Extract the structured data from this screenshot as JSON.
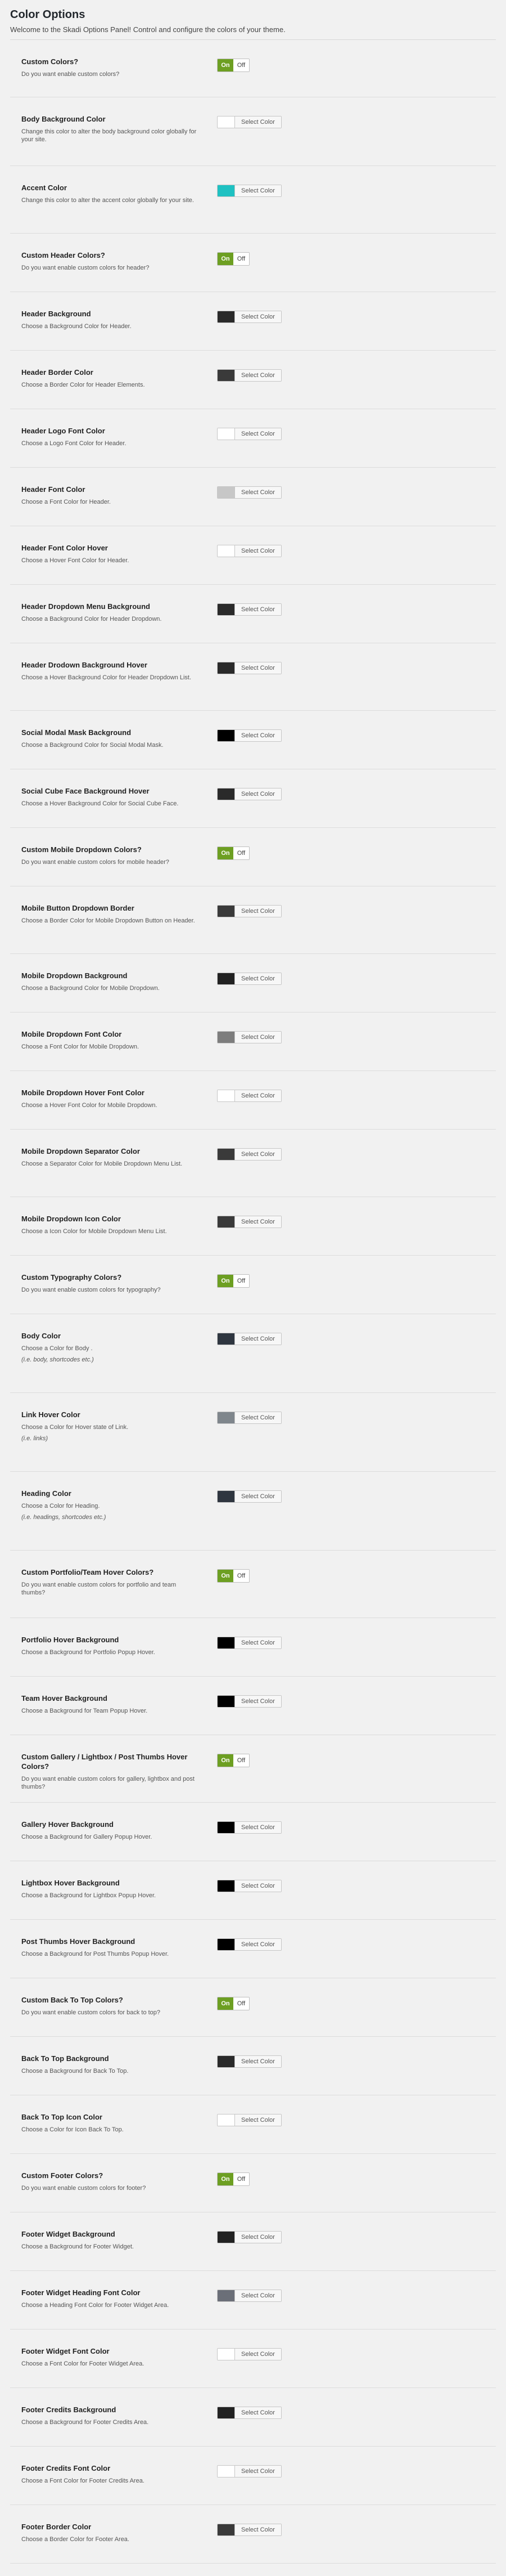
{
  "header": {
    "title": "Color Options",
    "intro": "Welcome to the Skadi Options Panel! Control and configure the colors of your theme."
  },
  "controls": {
    "on_label": "On",
    "off_label": "Off",
    "select_color_label": "Select Color"
  },
  "options": [
    {
      "kind": "toggle",
      "title": "Custom Colors?",
      "desc": "Do you want enable custom colors?",
      "value": "On"
    },
    {
      "kind": "color",
      "title": "Body Background Color",
      "desc": "Change this color to alter the body background color globally for your site.",
      "color": "#ffffff"
    },
    {
      "kind": "color",
      "title": "Accent Color",
      "desc": "Change this color to alter the accent color globally for your site.",
      "color": "#1fc1c2"
    },
    {
      "kind": "toggle",
      "title": "Custom Header Colors?",
      "desc": "Do you want enable custom colors for header?",
      "value": "On"
    },
    {
      "kind": "color",
      "title": "Header Background",
      "desc": "Choose a Background Color for Header.",
      "color": "#2a2a2a"
    },
    {
      "kind": "color",
      "title": "Header Border Color",
      "desc": "Choose a Border Color for Header Elements.",
      "color": "#3a3a3a"
    },
    {
      "kind": "color",
      "title": "Header Logo Font Color",
      "desc": "Choose a Logo Font Color for Header.",
      "color": "#ffffff"
    },
    {
      "kind": "color",
      "title": "Header Font Color",
      "desc": "Choose a Font Color for Header.",
      "color": "#c7c7c7"
    },
    {
      "kind": "color",
      "title": "Header Font Color Hover",
      "desc": "Choose a Hover Font Color for Header.",
      "color": "#ffffff"
    },
    {
      "kind": "color",
      "title": "Header Dropdown Menu Background",
      "desc": "Choose a Background Color for Header Dropdown.",
      "color": "#2a2a2a"
    },
    {
      "kind": "color",
      "title": "Header Drodown Background Hover",
      "desc": "Choose a Hover Background Color for Header Dropdown List.",
      "color": "#2a2a2a"
    },
    {
      "kind": "color",
      "title": "Social Modal Mask Background",
      "desc": "Choose a Background Color for Social Modal Mask.",
      "color": "#000000"
    },
    {
      "kind": "color",
      "title": "Social Cube Face Background Hover",
      "desc": "Choose a Hover Background Color for Social Cube Face.",
      "color": "#2a2a2a"
    },
    {
      "kind": "toggle",
      "title": "Custom Mobile Dropdown Colors?",
      "desc": "Do you want enable custom colors for mobile header?",
      "value": "On"
    },
    {
      "kind": "color",
      "title": "Mobile Button Dropdown Border",
      "desc": "Choose a Border Color for Mobile Dropdown Button on Header.",
      "color": "#3a3a3a"
    },
    {
      "kind": "color",
      "title": "Mobile Dropdown Background",
      "desc": "Choose a Background Color for Mobile Dropdown.",
      "color": "#222222"
    },
    {
      "kind": "color",
      "title": "Mobile Dropdown Font Color",
      "desc": "Choose a Font Color for Mobile Dropdown.",
      "color": "#7d7d7d"
    },
    {
      "kind": "color",
      "title": "Mobile Dropdown Hover Font Color",
      "desc": "Choose a Hover Font Color for Mobile Dropdown.",
      "color": "#ffffff"
    },
    {
      "kind": "color",
      "title": "Mobile Dropdown Separator Color",
      "desc": "Choose a Separator Color for Mobile Dropdown Menu List.",
      "color": "#3a3a3a"
    },
    {
      "kind": "color",
      "title": "Mobile Dropdown Icon Color",
      "desc": "Choose a Icon Color for Mobile Dropdown Menu List.",
      "color": "#3a3a3a"
    },
    {
      "kind": "toggle",
      "title": "Custom Typography Colors?",
      "desc": "Do you want enable custom colors for typography?",
      "value": "On"
    },
    {
      "kind": "color",
      "title": "Body Color",
      "desc": "Choose a Color for Body .",
      "example": "(i.e. body, shortcodes etc.)",
      "color": "#2f3640"
    },
    {
      "kind": "color",
      "title": "Link Hover Color",
      "desc": "Choose a Color for Hover state of Link.",
      "example": "(i.e. links)",
      "color": "#7f868c"
    },
    {
      "kind": "color",
      "title": "Heading Color",
      "desc": "Choose a Color for Heading.",
      "example": "(i.e. headings, shortcodes etc.)",
      "color": "#2f3640"
    },
    {
      "kind": "toggle",
      "title": "Custom Portfolio/Team Hover Colors?",
      "desc": "Do you want enable custom colors for portfolio and team thumbs?",
      "value": "On"
    },
    {
      "kind": "color",
      "title": "Portfolio Hover Background",
      "desc": "Choose a Background for Portfolio Popup Hover.",
      "color": "#000000"
    },
    {
      "kind": "color",
      "title": "Team Hover Background",
      "desc": "Choose a Background for Team Popup Hover.",
      "color": "#000000"
    },
    {
      "kind": "toggle",
      "title": "Custom Gallery / Lightbox / Post Thumbs Hover Colors?",
      "desc": "Do you want enable custom colors for gallery, lightbox and post thumbs?",
      "value": "On"
    },
    {
      "kind": "color",
      "title": "Gallery Hover Background",
      "desc": "Choose a Background for Gallery Popup Hover.",
      "color": "#000000"
    },
    {
      "kind": "color",
      "title": "Lightbox Hover Background",
      "desc": "Choose a Background for Lightbox Popup Hover.",
      "color": "#000000"
    },
    {
      "kind": "color",
      "title": "Post Thumbs Hover Background",
      "desc": "Choose a Background for Post Thumbs Popup Hover.",
      "color": "#000000"
    },
    {
      "kind": "toggle",
      "title": "Custom Back To Top Colors?",
      "desc": "Do you want enable custom colors for back to top?",
      "value": "On"
    },
    {
      "kind": "color",
      "title": "Back To Top Background",
      "desc": "Choose a Background for Back To Top.",
      "color": "#2a2a2a"
    },
    {
      "kind": "color",
      "title": "Back To Top Icon Color",
      "desc": "Choose a Color for Icon Back To Top.",
      "color": "#ffffff"
    },
    {
      "kind": "toggle",
      "title": "Custom Footer Colors?",
      "desc": "Do you want enable custom colors for footer?",
      "value": "On"
    },
    {
      "kind": "color",
      "title": "Footer Widget Background",
      "desc": "Choose a Background for Footer Widget.",
      "color": "#222222"
    },
    {
      "kind": "color",
      "title": "Footer Widget Heading Font Color",
      "desc": "Choose a Heading Font Color for Footer Widget Area.",
      "color": "#6b6f78"
    },
    {
      "kind": "color",
      "title": "Footer Widget Font Color",
      "desc": "Choose a Font Color for Footer Widget Area.",
      "color": "#ffffff"
    },
    {
      "kind": "color",
      "title": "Footer Credits Background",
      "desc": "Choose a Background for Footer Credits Area.",
      "color": "#222222"
    },
    {
      "kind": "color",
      "title": "Footer Credits Font Color",
      "desc": "Choose a Font Color for Footer Credits Area.",
      "color": "#ffffff"
    },
    {
      "kind": "color",
      "title": "Footer Border Color",
      "desc": "Choose a Border Color for Footer Area.",
      "color": "#3a3a3a"
    }
  ]
}
